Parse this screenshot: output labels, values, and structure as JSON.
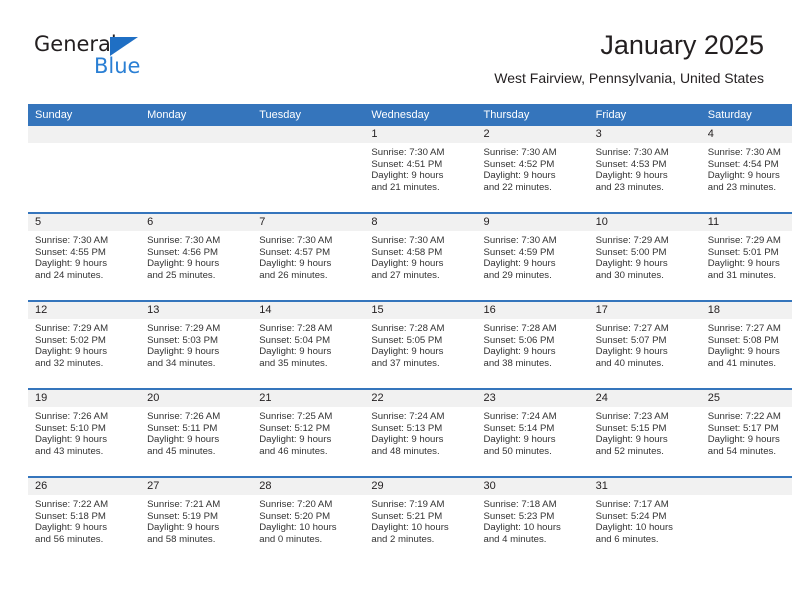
{
  "brand": {
    "name_dark": "General",
    "name_blue": "Blue",
    "accent_color": "#2a7fd4",
    "triangle_color": "#1f6fc4"
  },
  "header": {
    "title": "January 2025",
    "subtitle": "West Fairview, Pennsylvania, United States"
  },
  "calendar": {
    "header_bg": "#3575bc",
    "daynum_bg": "#f1f1f1",
    "weekdays": [
      "Sunday",
      "Monday",
      "Tuesday",
      "Wednesday",
      "Thursday",
      "Friday",
      "Saturday"
    ],
    "weeks": [
      [
        {
          "empty": true,
          "day": "",
          "sunrise": "",
          "sunset": "",
          "daylight1": "",
          "daylight2": ""
        },
        {
          "empty": true,
          "day": "",
          "sunrise": "",
          "sunset": "",
          "daylight1": "",
          "daylight2": ""
        },
        {
          "empty": true,
          "day": "",
          "sunrise": "",
          "sunset": "",
          "daylight1": "",
          "daylight2": ""
        },
        {
          "empty": false,
          "day": "1",
          "sunrise": "Sunrise: 7:30 AM",
          "sunset": "Sunset: 4:51 PM",
          "daylight1": "Daylight: 9 hours",
          "daylight2": "and 21 minutes."
        },
        {
          "empty": false,
          "day": "2",
          "sunrise": "Sunrise: 7:30 AM",
          "sunset": "Sunset: 4:52 PM",
          "daylight1": "Daylight: 9 hours",
          "daylight2": "and 22 minutes."
        },
        {
          "empty": false,
          "day": "3",
          "sunrise": "Sunrise: 7:30 AM",
          "sunset": "Sunset: 4:53 PM",
          "daylight1": "Daylight: 9 hours",
          "daylight2": "and 23 minutes."
        },
        {
          "empty": false,
          "day": "4",
          "sunrise": "Sunrise: 7:30 AM",
          "sunset": "Sunset: 4:54 PM",
          "daylight1": "Daylight: 9 hours",
          "daylight2": "and 23 minutes."
        }
      ],
      [
        {
          "empty": false,
          "day": "5",
          "sunrise": "Sunrise: 7:30 AM",
          "sunset": "Sunset: 4:55 PM",
          "daylight1": "Daylight: 9 hours",
          "daylight2": "and 24 minutes."
        },
        {
          "empty": false,
          "day": "6",
          "sunrise": "Sunrise: 7:30 AM",
          "sunset": "Sunset: 4:56 PM",
          "daylight1": "Daylight: 9 hours",
          "daylight2": "and 25 minutes."
        },
        {
          "empty": false,
          "day": "7",
          "sunrise": "Sunrise: 7:30 AM",
          "sunset": "Sunset: 4:57 PM",
          "daylight1": "Daylight: 9 hours",
          "daylight2": "and 26 minutes."
        },
        {
          "empty": false,
          "day": "8",
          "sunrise": "Sunrise: 7:30 AM",
          "sunset": "Sunset: 4:58 PM",
          "daylight1": "Daylight: 9 hours",
          "daylight2": "and 27 minutes."
        },
        {
          "empty": false,
          "day": "9",
          "sunrise": "Sunrise: 7:30 AM",
          "sunset": "Sunset: 4:59 PM",
          "daylight1": "Daylight: 9 hours",
          "daylight2": "and 29 minutes."
        },
        {
          "empty": false,
          "day": "10",
          "sunrise": "Sunrise: 7:29 AM",
          "sunset": "Sunset: 5:00 PM",
          "daylight1": "Daylight: 9 hours",
          "daylight2": "and 30 minutes."
        },
        {
          "empty": false,
          "day": "11",
          "sunrise": "Sunrise: 7:29 AM",
          "sunset": "Sunset: 5:01 PM",
          "daylight1": "Daylight: 9 hours",
          "daylight2": "and 31 minutes."
        }
      ],
      [
        {
          "empty": false,
          "day": "12",
          "sunrise": "Sunrise: 7:29 AM",
          "sunset": "Sunset: 5:02 PM",
          "daylight1": "Daylight: 9 hours",
          "daylight2": "and 32 minutes."
        },
        {
          "empty": false,
          "day": "13",
          "sunrise": "Sunrise: 7:29 AM",
          "sunset": "Sunset: 5:03 PM",
          "daylight1": "Daylight: 9 hours",
          "daylight2": "and 34 minutes."
        },
        {
          "empty": false,
          "day": "14",
          "sunrise": "Sunrise: 7:28 AM",
          "sunset": "Sunset: 5:04 PM",
          "daylight1": "Daylight: 9 hours",
          "daylight2": "and 35 minutes."
        },
        {
          "empty": false,
          "day": "15",
          "sunrise": "Sunrise: 7:28 AM",
          "sunset": "Sunset: 5:05 PM",
          "daylight1": "Daylight: 9 hours",
          "daylight2": "and 37 minutes."
        },
        {
          "empty": false,
          "day": "16",
          "sunrise": "Sunrise: 7:28 AM",
          "sunset": "Sunset: 5:06 PM",
          "daylight1": "Daylight: 9 hours",
          "daylight2": "and 38 minutes."
        },
        {
          "empty": false,
          "day": "17",
          "sunrise": "Sunrise: 7:27 AM",
          "sunset": "Sunset: 5:07 PM",
          "daylight1": "Daylight: 9 hours",
          "daylight2": "and 40 minutes."
        },
        {
          "empty": false,
          "day": "18",
          "sunrise": "Sunrise: 7:27 AM",
          "sunset": "Sunset: 5:08 PM",
          "daylight1": "Daylight: 9 hours",
          "daylight2": "and 41 minutes."
        }
      ],
      [
        {
          "empty": false,
          "day": "19",
          "sunrise": "Sunrise: 7:26 AM",
          "sunset": "Sunset: 5:10 PM",
          "daylight1": "Daylight: 9 hours",
          "daylight2": "and 43 minutes."
        },
        {
          "empty": false,
          "day": "20",
          "sunrise": "Sunrise: 7:26 AM",
          "sunset": "Sunset: 5:11 PM",
          "daylight1": "Daylight: 9 hours",
          "daylight2": "and 45 minutes."
        },
        {
          "empty": false,
          "day": "21",
          "sunrise": "Sunrise: 7:25 AM",
          "sunset": "Sunset: 5:12 PM",
          "daylight1": "Daylight: 9 hours",
          "daylight2": "and 46 minutes."
        },
        {
          "empty": false,
          "day": "22",
          "sunrise": "Sunrise: 7:24 AM",
          "sunset": "Sunset: 5:13 PM",
          "daylight1": "Daylight: 9 hours",
          "daylight2": "and 48 minutes."
        },
        {
          "empty": false,
          "day": "23",
          "sunrise": "Sunrise: 7:24 AM",
          "sunset": "Sunset: 5:14 PM",
          "daylight1": "Daylight: 9 hours",
          "daylight2": "and 50 minutes."
        },
        {
          "empty": false,
          "day": "24",
          "sunrise": "Sunrise: 7:23 AM",
          "sunset": "Sunset: 5:15 PM",
          "daylight1": "Daylight: 9 hours",
          "daylight2": "and 52 minutes."
        },
        {
          "empty": false,
          "day": "25",
          "sunrise": "Sunrise: 7:22 AM",
          "sunset": "Sunset: 5:17 PM",
          "daylight1": "Daylight: 9 hours",
          "daylight2": "and 54 minutes."
        }
      ],
      [
        {
          "empty": false,
          "day": "26",
          "sunrise": "Sunrise: 7:22 AM",
          "sunset": "Sunset: 5:18 PM",
          "daylight1": "Daylight: 9 hours",
          "daylight2": "and 56 minutes."
        },
        {
          "empty": false,
          "day": "27",
          "sunrise": "Sunrise: 7:21 AM",
          "sunset": "Sunset: 5:19 PM",
          "daylight1": "Daylight: 9 hours",
          "daylight2": "and 58 minutes."
        },
        {
          "empty": false,
          "day": "28",
          "sunrise": "Sunrise: 7:20 AM",
          "sunset": "Sunset: 5:20 PM",
          "daylight1": "Daylight: 10 hours",
          "daylight2": "and 0 minutes."
        },
        {
          "empty": false,
          "day": "29",
          "sunrise": "Sunrise: 7:19 AM",
          "sunset": "Sunset: 5:21 PM",
          "daylight1": "Daylight: 10 hours",
          "daylight2": "and 2 minutes."
        },
        {
          "empty": false,
          "day": "30",
          "sunrise": "Sunrise: 7:18 AM",
          "sunset": "Sunset: 5:23 PM",
          "daylight1": "Daylight: 10 hours",
          "daylight2": "and 4 minutes."
        },
        {
          "empty": false,
          "day": "31",
          "sunrise": "Sunrise: 7:17 AM",
          "sunset": "Sunset: 5:24 PM",
          "daylight1": "Daylight: 10 hours",
          "daylight2": "and 6 minutes."
        },
        {
          "empty": true,
          "day": "",
          "sunrise": "",
          "sunset": "",
          "daylight1": "",
          "daylight2": ""
        }
      ]
    ]
  }
}
